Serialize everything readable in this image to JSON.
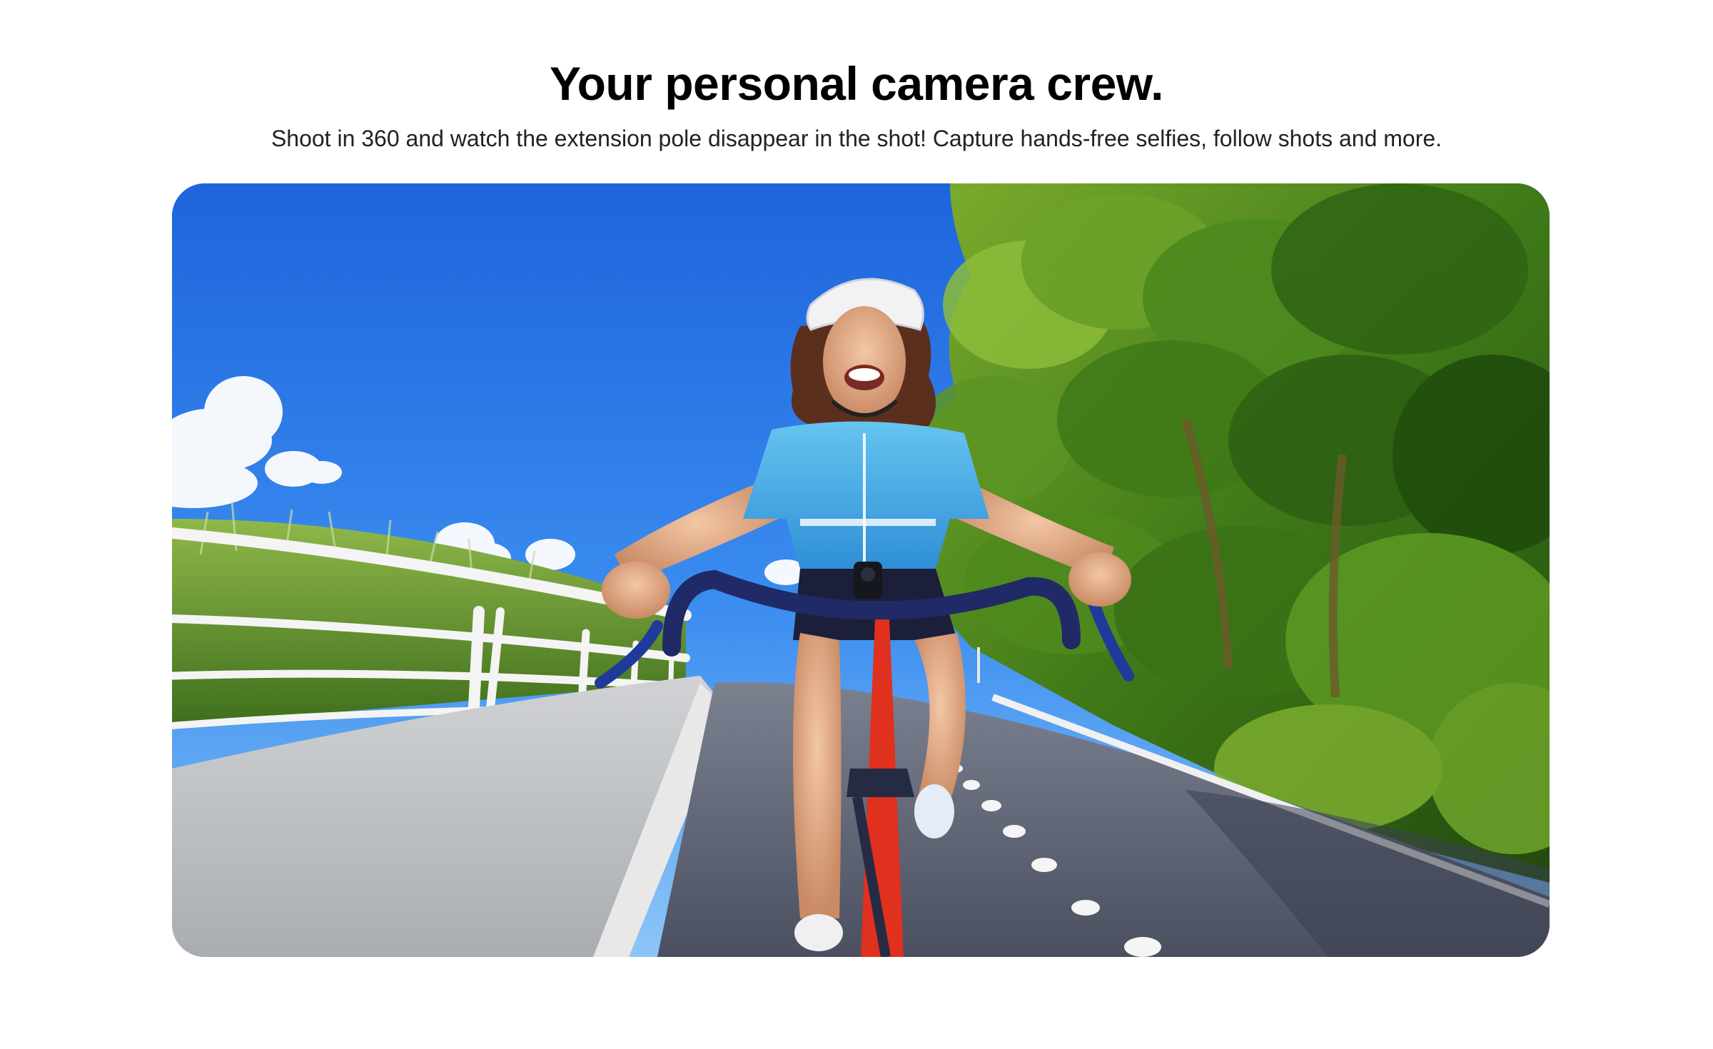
{
  "hero": {
    "title": "Your personal camera crew.",
    "subtitle": "Shoot in 360 and watch the extension pole disappear in the shot! Capture hands-free selfies, follow shots and more."
  },
  "media": {
    "kind": "photo",
    "scene": "cyclist-selfie-360",
    "colors": {
      "sky_top": "#1f6fe6",
      "sky_bottom": "#6fb6f5",
      "trees_dark": "#1f4a10",
      "trees_mid": "#4f8a1d",
      "trees_light": "#9cc43a",
      "grass": "#5f8f2a",
      "path": "#b9bcc0",
      "bike_lane": "#5a6070",
      "jersey": "#4fb3ea",
      "bike_frame": "#e0301e",
      "handlebar": "#202a66",
      "railing": "#f2f2f2"
    }
  }
}
